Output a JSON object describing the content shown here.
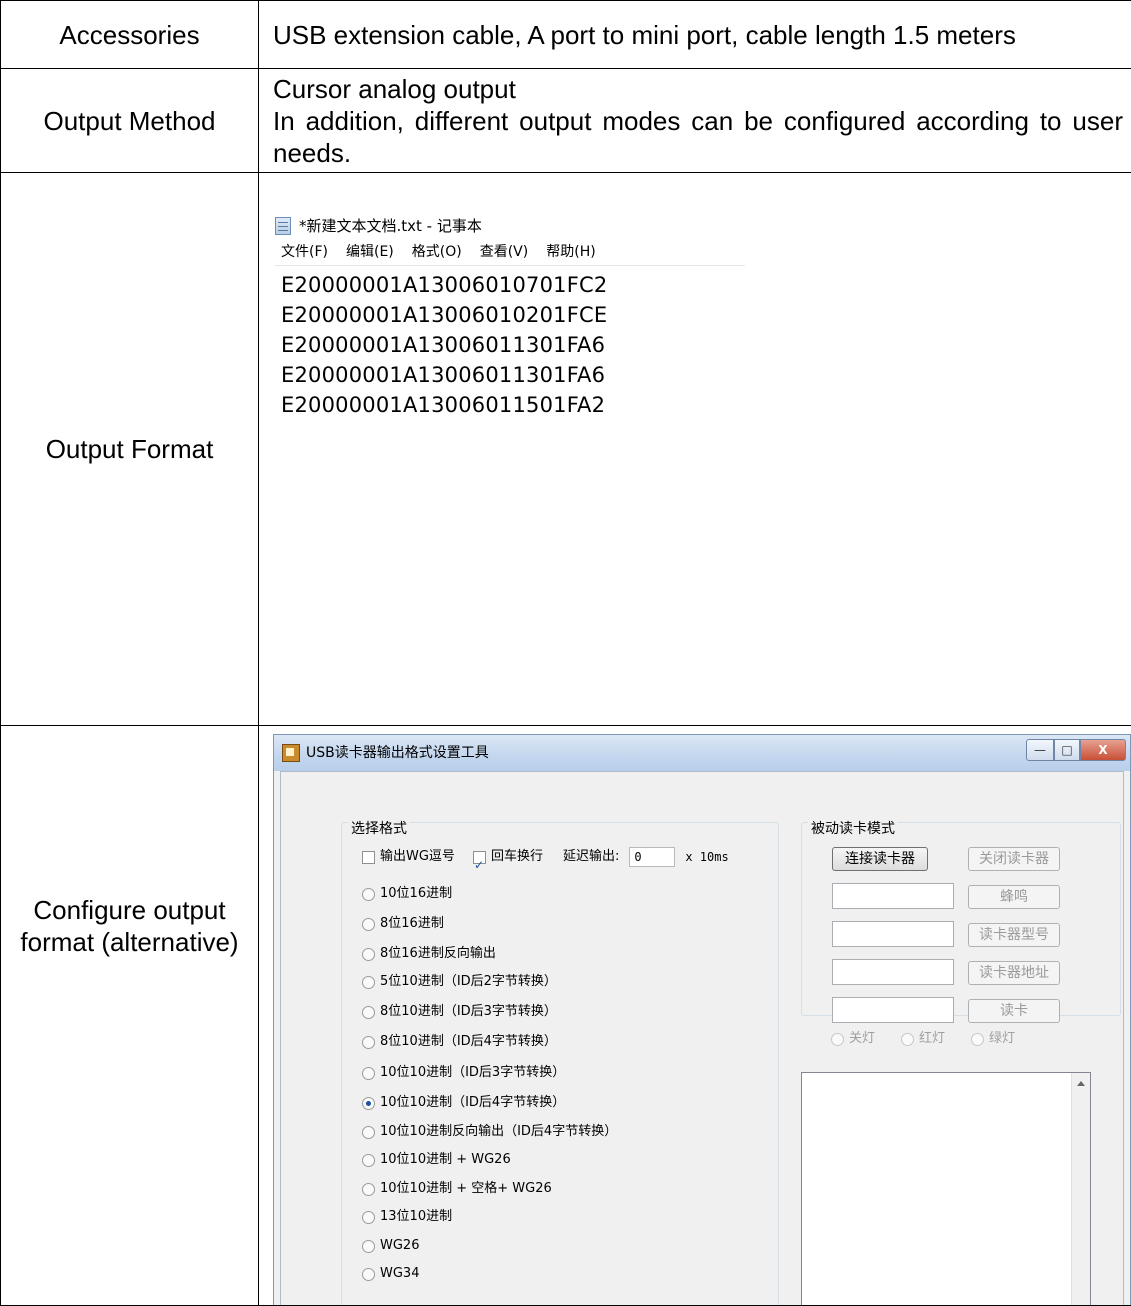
{
  "rows": {
    "accessories": {
      "label": "Accessories",
      "value": "USB extension cable, A port to mini port, cable length 1.5 meters"
    },
    "output_method": {
      "label": "Output Method",
      "line1": "Cursor analog output",
      "line2": "In addition, different output modes can be configured according to user needs."
    },
    "output_format": {
      "label": "Output Format"
    },
    "configure": {
      "label": "Configure output format (alternative)"
    }
  },
  "notepad": {
    "title": "*新建文本文档.txt - 记事本",
    "menu": [
      "文件(F)",
      "编辑(E)",
      "格式(O)",
      "查看(V)",
      "帮助(H)"
    ],
    "lines": [
      "E20000001A13006010701FC2",
      "E20000001A13006010201FCE",
      "E20000001A13006011301FA6",
      "E20000001A13006011301FA6",
      "E20000001A13006011501FA2"
    ]
  },
  "tool": {
    "title": "USB读卡器输出格式设置工具",
    "window_buttons": {
      "close": "X"
    },
    "select_format": {
      "legend": "选择格式",
      "wg_comma": {
        "label": "输出WG逗号",
        "checked": false
      },
      "enter_newline": {
        "label": "回车换行",
        "checked": true
      },
      "delay_label": "延迟输出:",
      "delay_value": "0",
      "delay_unit": "x 10ms",
      "options": [
        "10位16进制",
        "8位16进制",
        "8位16进制反向输出",
        "5位10进制（ID后2字节转换）",
        "8位10进制（ID后3字节转换）",
        "8位10进制（ID后4字节转换）",
        "10位10进制（ID后3字节转换）",
        "10位10进制（ID后4字节转换）",
        "10位10进制反向输出（ID后4字节转换）",
        "10位10进制 + WG26",
        "10位10进制 + 空格+ WG26",
        "13位10进制",
        "WG26",
        "WG34"
      ],
      "selected_index": 7
    },
    "passive_mode": {
      "legend": "被动读卡模式",
      "connect": "连接读卡器",
      "close": "关闭读卡器",
      "beep": "蜂鸣",
      "model": "读卡器型号",
      "address": "读卡器地址",
      "read": "读卡",
      "lights": [
        "关灯",
        "红灯",
        "绿灯"
      ]
    }
  }
}
